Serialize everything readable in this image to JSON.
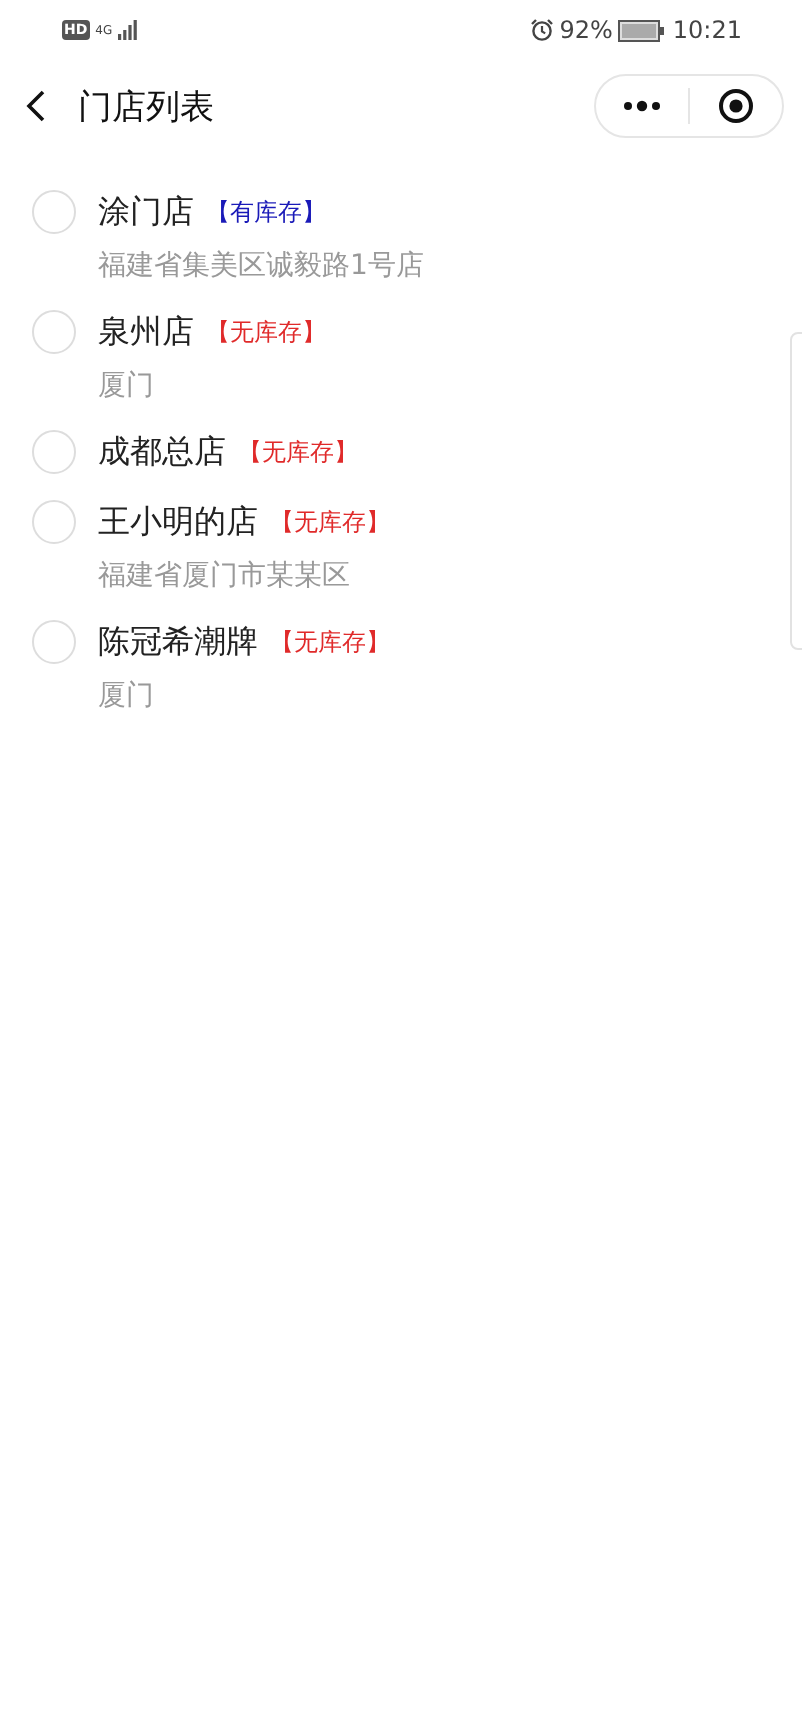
{
  "status_bar": {
    "hd": "HD",
    "network": "4G",
    "battery": "92%",
    "time": "10:21"
  },
  "nav": {
    "title": "门店列表"
  },
  "stores": [
    {
      "name": "涂门店",
      "stock": "【有库存】",
      "in_stock": true,
      "address": "福建省集美区诚毅路1号店",
      "selected": false
    },
    {
      "name": "泉州店",
      "stock": "【无库存】",
      "in_stock": false,
      "address": "厦门",
      "selected": false
    },
    {
      "name": "成都总店",
      "stock": "【无库存】",
      "in_stock": false,
      "selected": false
    },
    {
      "name": "王小明的店",
      "stock": "【无库存】",
      "in_stock": false,
      "address": "福建省厦门市某某区",
      "selected": false
    },
    {
      "name": "陈冠希潮牌",
      "stock": "【无库存】",
      "in_stock": false,
      "address": "厦门",
      "selected": false
    }
  ]
}
